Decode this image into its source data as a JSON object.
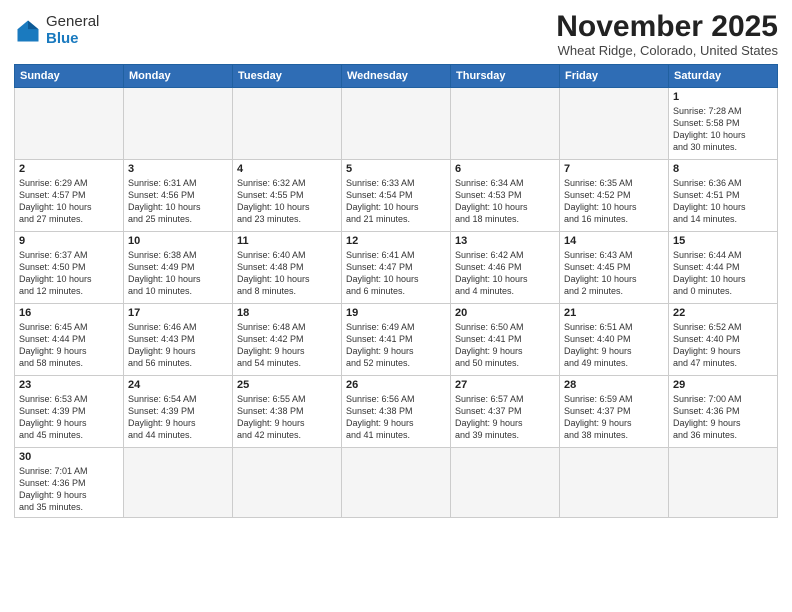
{
  "header": {
    "logo_general": "General",
    "logo_blue": "Blue",
    "title": "November 2025",
    "location": "Wheat Ridge, Colorado, United States"
  },
  "days_of_week": [
    "Sunday",
    "Monday",
    "Tuesday",
    "Wednesday",
    "Thursday",
    "Friday",
    "Saturday"
  ],
  "weeks": [
    [
      {
        "day": "",
        "info": ""
      },
      {
        "day": "",
        "info": ""
      },
      {
        "day": "",
        "info": ""
      },
      {
        "day": "",
        "info": ""
      },
      {
        "day": "",
        "info": ""
      },
      {
        "day": "",
        "info": ""
      },
      {
        "day": "1",
        "info": "Sunrise: 7:28 AM\nSunset: 5:58 PM\nDaylight: 10 hours\nand 30 minutes."
      }
    ],
    [
      {
        "day": "2",
        "info": "Sunrise: 6:29 AM\nSunset: 4:57 PM\nDaylight: 10 hours\nand 27 minutes."
      },
      {
        "day": "3",
        "info": "Sunrise: 6:31 AM\nSunset: 4:56 PM\nDaylight: 10 hours\nand 25 minutes."
      },
      {
        "day": "4",
        "info": "Sunrise: 6:32 AM\nSunset: 4:55 PM\nDaylight: 10 hours\nand 23 minutes."
      },
      {
        "day": "5",
        "info": "Sunrise: 6:33 AM\nSunset: 4:54 PM\nDaylight: 10 hours\nand 21 minutes."
      },
      {
        "day": "6",
        "info": "Sunrise: 6:34 AM\nSunset: 4:53 PM\nDaylight: 10 hours\nand 18 minutes."
      },
      {
        "day": "7",
        "info": "Sunrise: 6:35 AM\nSunset: 4:52 PM\nDaylight: 10 hours\nand 16 minutes."
      },
      {
        "day": "8",
        "info": "Sunrise: 6:36 AM\nSunset: 4:51 PM\nDaylight: 10 hours\nand 14 minutes."
      }
    ],
    [
      {
        "day": "9",
        "info": "Sunrise: 6:37 AM\nSunset: 4:50 PM\nDaylight: 10 hours\nand 12 minutes."
      },
      {
        "day": "10",
        "info": "Sunrise: 6:38 AM\nSunset: 4:49 PM\nDaylight: 10 hours\nand 10 minutes."
      },
      {
        "day": "11",
        "info": "Sunrise: 6:40 AM\nSunset: 4:48 PM\nDaylight: 10 hours\nand 8 minutes."
      },
      {
        "day": "12",
        "info": "Sunrise: 6:41 AM\nSunset: 4:47 PM\nDaylight: 10 hours\nand 6 minutes."
      },
      {
        "day": "13",
        "info": "Sunrise: 6:42 AM\nSunset: 4:46 PM\nDaylight: 10 hours\nand 4 minutes."
      },
      {
        "day": "14",
        "info": "Sunrise: 6:43 AM\nSunset: 4:45 PM\nDaylight: 10 hours\nand 2 minutes."
      },
      {
        "day": "15",
        "info": "Sunrise: 6:44 AM\nSunset: 4:44 PM\nDaylight: 10 hours\nand 0 minutes."
      }
    ],
    [
      {
        "day": "16",
        "info": "Sunrise: 6:45 AM\nSunset: 4:44 PM\nDaylight: 9 hours\nand 58 minutes."
      },
      {
        "day": "17",
        "info": "Sunrise: 6:46 AM\nSunset: 4:43 PM\nDaylight: 9 hours\nand 56 minutes."
      },
      {
        "day": "18",
        "info": "Sunrise: 6:48 AM\nSunset: 4:42 PM\nDaylight: 9 hours\nand 54 minutes."
      },
      {
        "day": "19",
        "info": "Sunrise: 6:49 AM\nSunset: 4:41 PM\nDaylight: 9 hours\nand 52 minutes."
      },
      {
        "day": "20",
        "info": "Sunrise: 6:50 AM\nSunset: 4:41 PM\nDaylight: 9 hours\nand 50 minutes."
      },
      {
        "day": "21",
        "info": "Sunrise: 6:51 AM\nSunset: 4:40 PM\nDaylight: 9 hours\nand 49 minutes."
      },
      {
        "day": "22",
        "info": "Sunrise: 6:52 AM\nSunset: 4:40 PM\nDaylight: 9 hours\nand 47 minutes."
      }
    ],
    [
      {
        "day": "23",
        "info": "Sunrise: 6:53 AM\nSunset: 4:39 PM\nDaylight: 9 hours\nand 45 minutes."
      },
      {
        "day": "24",
        "info": "Sunrise: 6:54 AM\nSunset: 4:39 PM\nDaylight: 9 hours\nand 44 minutes."
      },
      {
        "day": "25",
        "info": "Sunrise: 6:55 AM\nSunset: 4:38 PM\nDaylight: 9 hours\nand 42 minutes."
      },
      {
        "day": "26",
        "info": "Sunrise: 6:56 AM\nSunset: 4:38 PM\nDaylight: 9 hours\nand 41 minutes."
      },
      {
        "day": "27",
        "info": "Sunrise: 6:57 AM\nSunset: 4:37 PM\nDaylight: 9 hours\nand 39 minutes."
      },
      {
        "day": "28",
        "info": "Sunrise: 6:59 AM\nSunset: 4:37 PM\nDaylight: 9 hours\nand 38 minutes."
      },
      {
        "day": "29",
        "info": "Sunrise: 7:00 AM\nSunset: 4:36 PM\nDaylight: 9 hours\nand 36 minutes."
      }
    ],
    [
      {
        "day": "30",
        "info": "Sunrise: 7:01 AM\nSunset: 4:36 PM\nDaylight: 9 hours\nand 35 minutes."
      },
      {
        "day": "",
        "info": ""
      },
      {
        "day": "",
        "info": ""
      },
      {
        "day": "",
        "info": ""
      },
      {
        "day": "",
        "info": ""
      },
      {
        "day": "",
        "info": ""
      },
      {
        "day": "",
        "info": ""
      }
    ]
  ]
}
